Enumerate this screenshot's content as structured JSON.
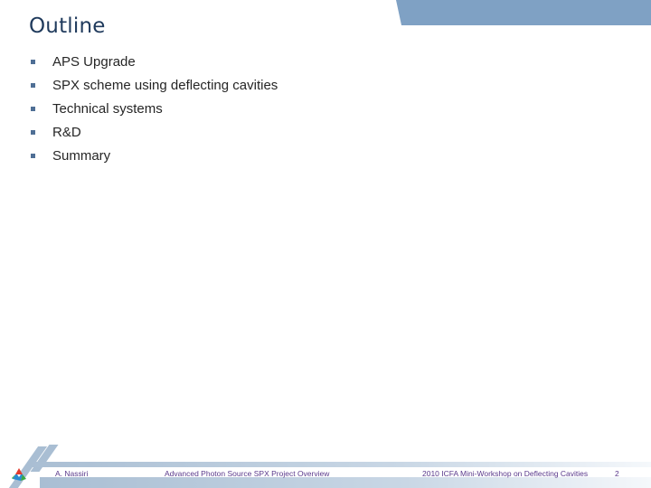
{
  "slide": {
    "title": "Outline",
    "bullets": [
      "APS Upgrade",
      "SPX scheme using deflecting cavities",
      "Technical systems",
      "R&D",
      "Summary"
    ]
  },
  "footer": {
    "author": "A. Nassiri",
    "project": "Advanced Photon Source SPX Project Overview",
    "event": "2010 ICFA Mini-Workshop on Deflecting Cavities",
    "page_number": "2"
  },
  "colors": {
    "accent_band": "#7fa1c4",
    "title": "#1f3a5c",
    "footer_text": "#5b3a8c"
  }
}
